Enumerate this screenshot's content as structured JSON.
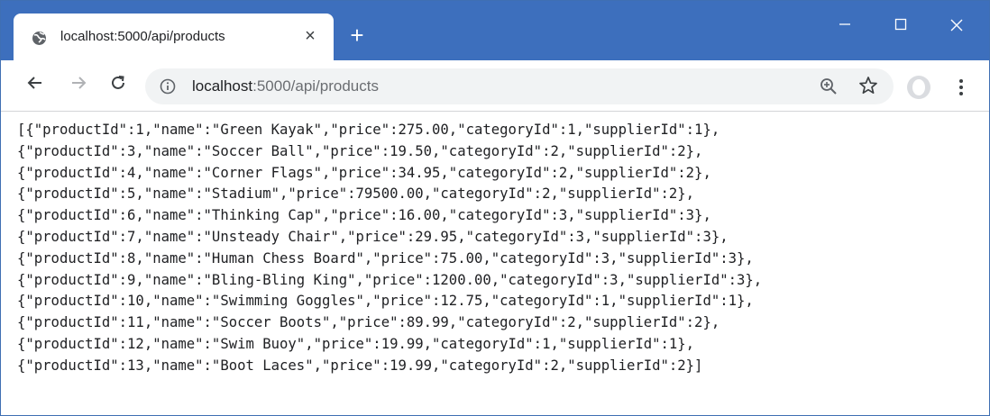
{
  "browser": {
    "tab": {
      "favicon": "globe-icon",
      "title": "localhost:5000/api/products",
      "close_label": "×"
    },
    "new_tab_label": "+",
    "window_controls": {
      "minimize": "–",
      "maximize": "☐",
      "close": "✕"
    },
    "toolbar": {
      "back": "←",
      "forward": "→",
      "reload": "C"
    },
    "address_bar": {
      "url_host": "localhost",
      "url_rest": ":5000/api/products"
    },
    "colors": {
      "titlebar": "#3d6fbd",
      "omnibox": "#f1f3f4"
    }
  },
  "page": {
    "lines": [
      "[{\"productId\":1,\"name\":\"Green Kayak\",\"price\":275.00,\"categoryId\":1,\"supplierId\":1},",
      "{\"productId\":3,\"name\":\"Soccer Ball\",\"price\":19.50,\"categoryId\":2,\"supplierId\":2},",
      "{\"productId\":4,\"name\":\"Corner Flags\",\"price\":34.95,\"categoryId\":2,\"supplierId\":2},",
      "{\"productId\":5,\"name\":\"Stadium\",\"price\":79500.00,\"categoryId\":2,\"supplierId\":2},",
      "{\"productId\":6,\"name\":\"Thinking Cap\",\"price\":16.00,\"categoryId\":3,\"supplierId\":3},",
      "{\"productId\":7,\"name\":\"Unsteady Chair\",\"price\":29.95,\"categoryId\":3,\"supplierId\":3},",
      "{\"productId\":8,\"name\":\"Human Chess Board\",\"price\":75.00,\"categoryId\":3,\"supplierId\":3},",
      "{\"productId\":9,\"name\":\"Bling-Bling King\",\"price\":1200.00,\"categoryId\":3,\"supplierId\":3},",
      "{\"productId\":10,\"name\":\"Swimming Goggles\",\"price\":12.75,\"categoryId\":1,\"supplierId\":1},",
      "{\"productId\":11,\"name\":\"Soccer Boots\",\"price\":89.99,\"categoryId\":2,\"supplierId\":2},",
      "{\"productId\":12,\"name\":\"Swim Buoy\",\"price\":19.99,\"categoryId\":1,\"supplierId\":1},",
      "{\"productId\":13,\"name\":\"Boot Laces\",\"price\":19.99,\"categoryId\":2,\"supplierId\":2}]"
    ]
  }
}
